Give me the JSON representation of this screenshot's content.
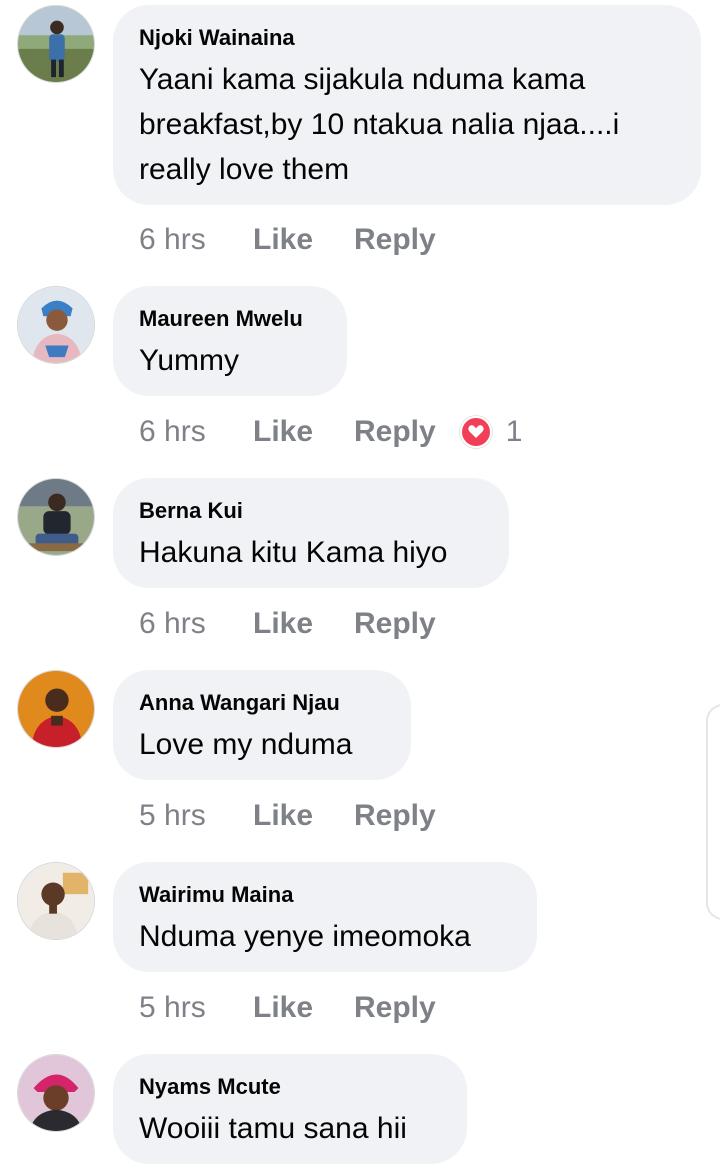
{
  "comments": [
    {
      "author": "Njoki Wainaina",
      "lines": [
        "Yaani kama sijakula nduma kama",
        "breakfast,by 10 ntakua nalia njaa....i",
        "really love them"
      ],
      "time": "6 hrs",
      "like_label": "Like",
      "reply_label": "Reply"
    },
    {
      "author": "Maureen Mwelu",
      "lines": [
        "Yummy"
      ],
      "time": "6 hrs",
      "like_label": "Like",
      "reply_label": "Reply",
      "reaction_count": "1",
      "reaction_icon": "heart-icon"
    },
    {
      "author": "Berna Kui",
      "lines": [
        "Hakuna kitu Kama hiyo"
      ],
      "time": "6 hrs",
      "like_label": "Like",
      "reply_label": "Reply"
    },
    {
      "author": "Anna Wangari Njau",
      "lines": [
        "Love my nduma"
      ],
      "time": "5 hrs",
      "like_label": "Like",
      "reply_label": "Reply"
    },
    {
      "author": "Wairimu Maina",
      "lines": [
        "Nduma yenye imeomoka"
      ],
      "time": "5 hrs",
      "like_label": "Like",
      "reply_label": "Reply"
    },
    {
      "author": "Nyams Mcute",
      "lines": [
        "Wooiii tamu sana hii"
      ]
    }
  ],
  "colors": {
    "bubble_bg": "#f0f2f5",
    "meta_text": "#7e8187",
    "heart_reaction": "#f33e58"
  }
}
